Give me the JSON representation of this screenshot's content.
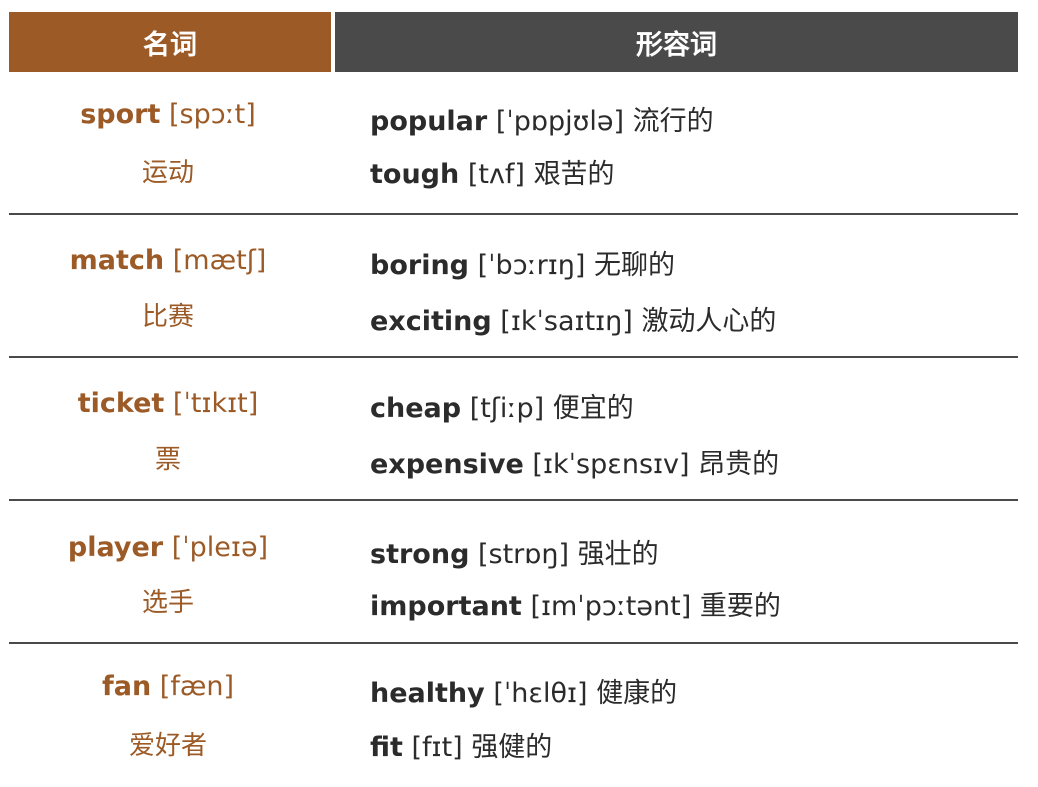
{
  "header": {
    "noun": "名词",
    "adjective": "形容词"
  },
  "rows": [
    {
      "noun": {
        "word": "sport",
        "ipa": "[spɔːt]",
        "meaning": "运动"
      },
      "adjectives": [
        {
          "word": "popular",
          "ipa": "[ˈpɒpjʊlə]",
          "meaning": "流行的"
        },
        {
          "word": "tough",
          "ipa": "[tʌf]",
          "meaning": "艰苦的"
        }
      ]
    },
    {
      "noun": {
        "word": "match",
        "ipa": "[mætʃ]",
        "meaning": "比赛"
      },
      "adjectives": [
        {
          "word": "boring",
          "ipa": "[ˈbɔːrɪŋ]",
          "meaning": "无聊的"
        },
        {
          "word": "exciting",
          "ipa": "[ɪkˈsaɪtɪŋ]",
          "meaning": "激动人心的"
        }
      ]
    },
    {
      "noun": {
        "word": "ticket",
        "ipa": "[ˈtɪkɪt]",
        "meaning": "票"
      },
      "adjectives": [
        {
          "word": "cheap",
          "ipa": "[tʃiːp]",
          "meaning": "便宜的"
        },
        {
          "word": "expensive",
          "ipa": "[ɪkˈspɛnsɪv]",
          "meaning": "昂贵的"
        }
      ]
    },
    {
      "noun": {
        "word": "player",
        "ipa": "[ˈpleɪə]",
        "meaning": "选手"
      },
      "adjectives": [
        {
          "word": "strong",
          "ipa": "[strɒŋ]",
          "meaning": "强壮的"
        },
        {
          "word": "important",
          "ipa": "[ɪmˈpɔːtənt]",
          "meaning": "重要的"
        }
      ]
    },
    {
      "noun": {
        "word": "fan",
        "ipa": "[fæn]",
        "meaning": "爱好者"
      },
      "adjectives": [
        {
          "word": "healthy",
          "ipa": "[ˈhɛlθɪ]",
          "meaning": "健康的"
        },
        {
          "word": "fit",
          "ipa": "[fɪt]",
          "meaning": "强健的"
        }
      ]
    }
  ],
  "colors": {
    "noun_header": "#9b5a26",
    "adj_header": "#4a4a4a",
    "noun_text": "#9b5a26",
    "adj_text": "#2b2b2b"
  }
}
